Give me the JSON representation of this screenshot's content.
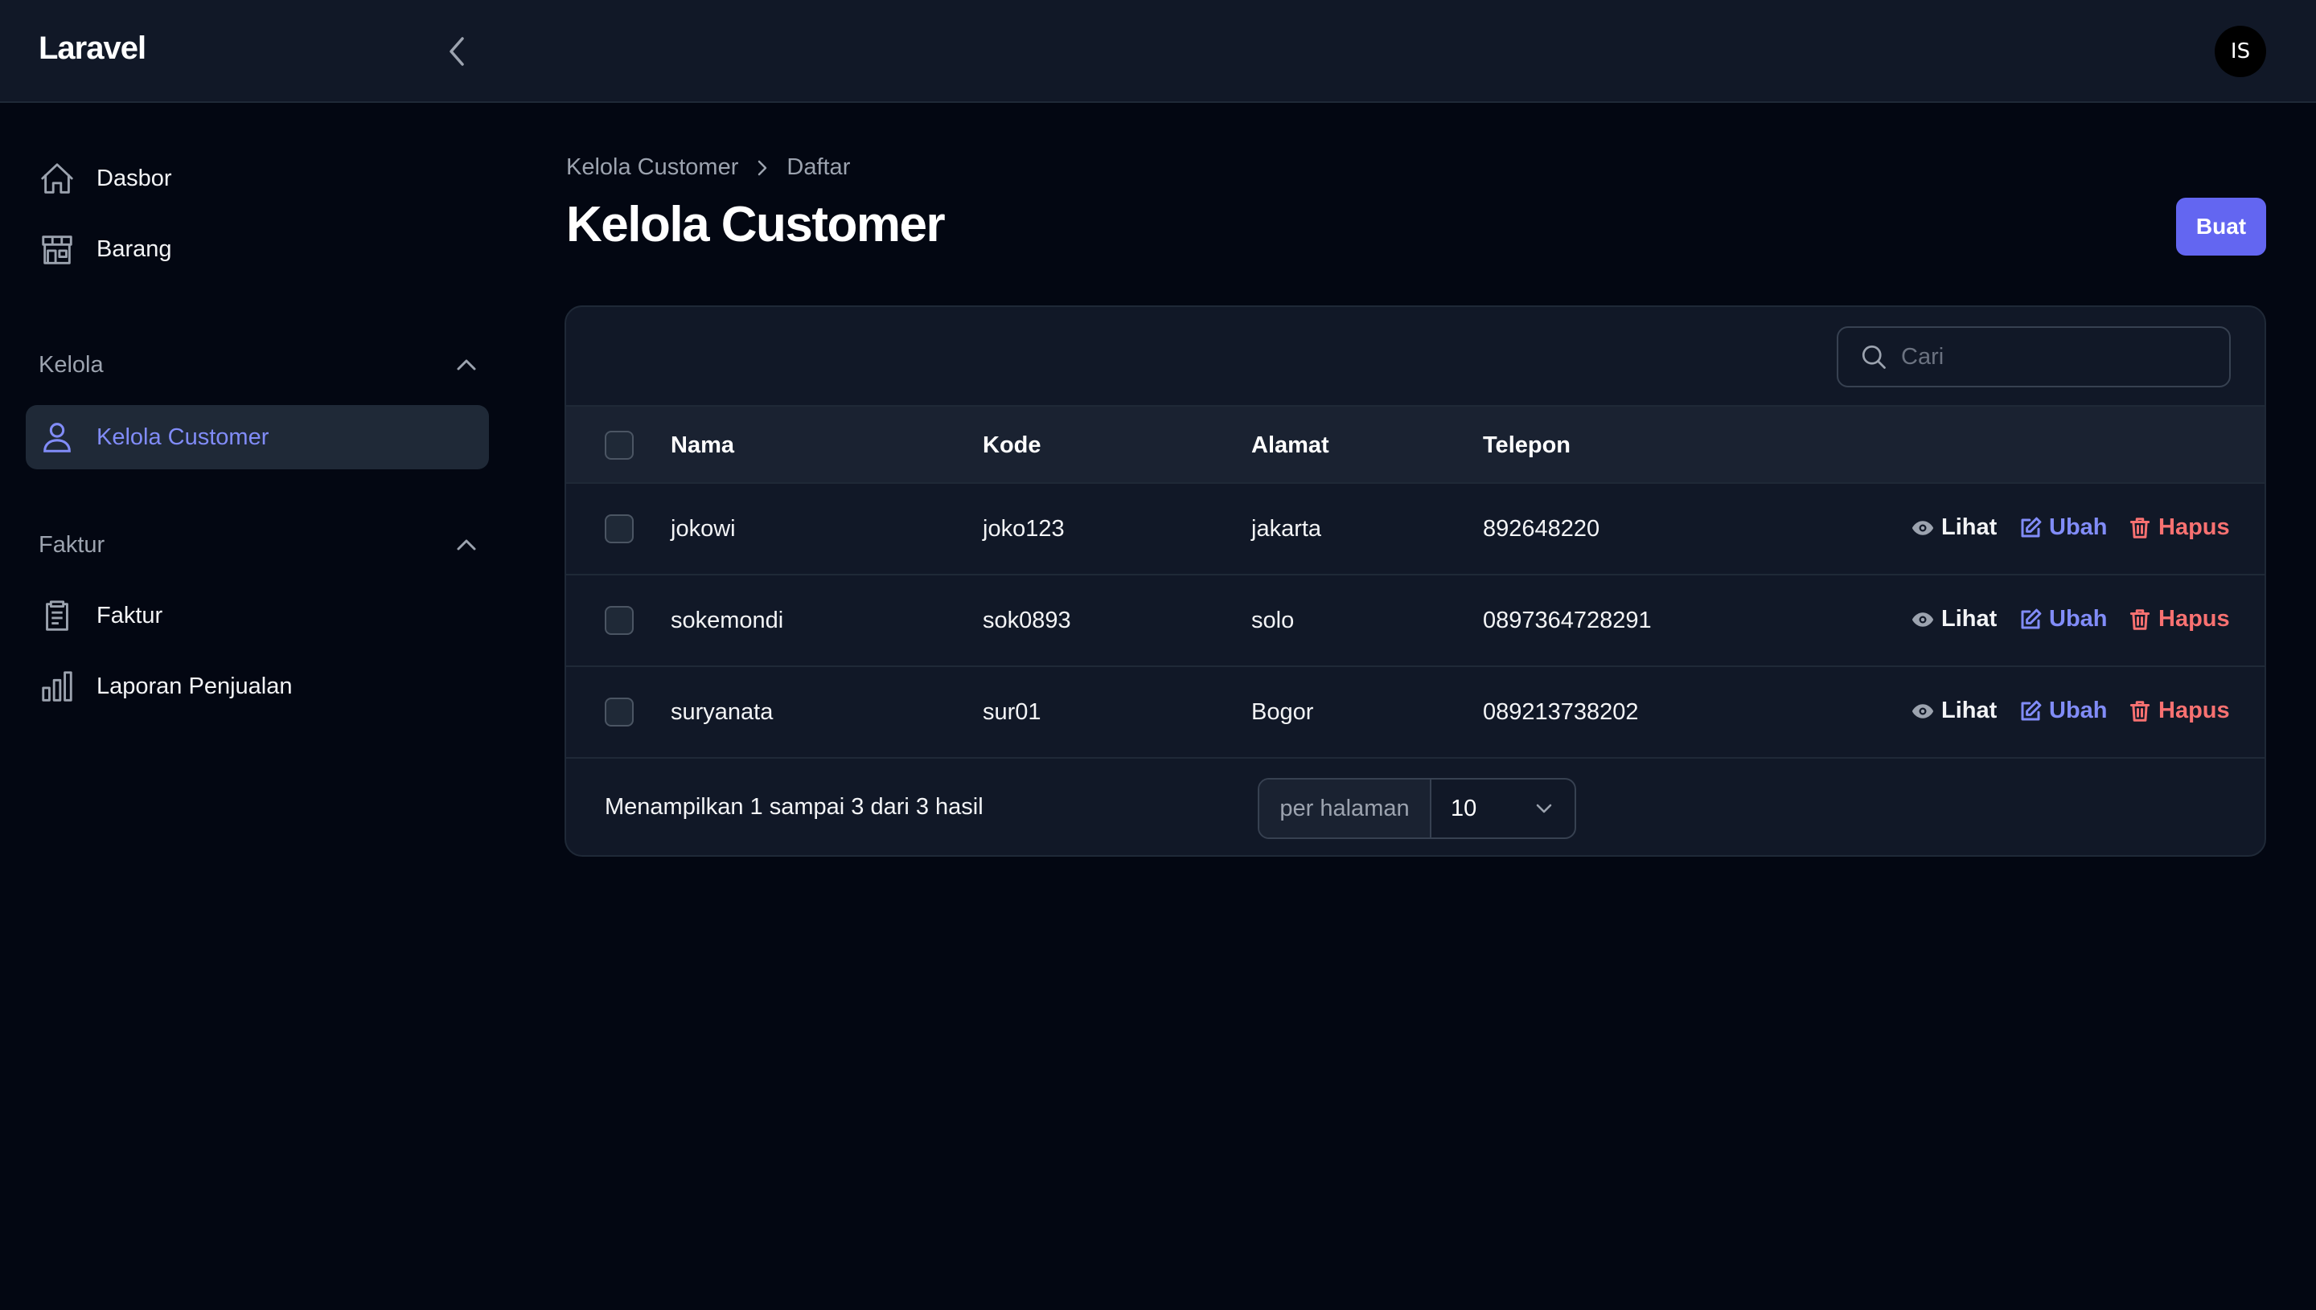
{
  "app": {
    "brand": "Laravel",
    "user_initials": "IS"
  },
  "sidebar": {
    "items": [
      {
        "label": "Dasbor",
        "icon": "home-icon"
      },
      {
        "label": "Barang",
        "icon": "store-icon"
      }
    ],
    "groups": [
      {
        "label": "Kelola",
        "items": [
          {
            "label": "Kelola Customer",
            "icon": "user-icon",
            "active": true
          }
        ]
      },
      {
        "label": "Faktur",
        "items": [
          {
            "label": "Faktur",
            "icon": "clipboard-icon"
          },
          {
            "label": "Laporan Penjualan",
            "icon": "bar-chart-icon"
          }
        ]
      }
    ]
  },
  "breadcrumb": {
    "parent": "Kelola Customer",
    "current": "Daftar"
  },
  "page": {
    "title": "Kelola Customer",
    "create_label": "Buat"
  },
  "search": {
    "placeholder": "Cari"
  },
  "table": {
    "columns": [
      "Nama",
      "Kode",
      "Alamat",
      "Telepon"
    ],
    "rows": [
      {
        "nama": "jokowi",
        "kode": "joko123",
        "alamat": "jakarta",
        "telepon": "892648220"
      },
      {
        "nama": "sokemondi",
        "kode": "sok0893",
        "alamat": "solo",
        "telepon": "0897364728291"
      },
      {
        "nama": "suryanata",
        "kode": "sur01",
        "alamat": "Bogor",
        "telepon": "089213738202"
      }
    ],
    "actions": {
      "view": "Lihat",
      "edit": "Ubah",
      "delete": "Hapus"
    }
  },
  "footer": {
    "summary": "Menampilkan 1 sampai 3 dari 3 hasil",
    "per_page_label": "per halaman",
    "per_page_value": "10"
  },
  "colors": {
    "primary": "#6366f1",
    "accent_text": "#818cf8",
    "danger": "#f87171",
    "background": "#030712",
    "surface": "#111827"
  }
}
